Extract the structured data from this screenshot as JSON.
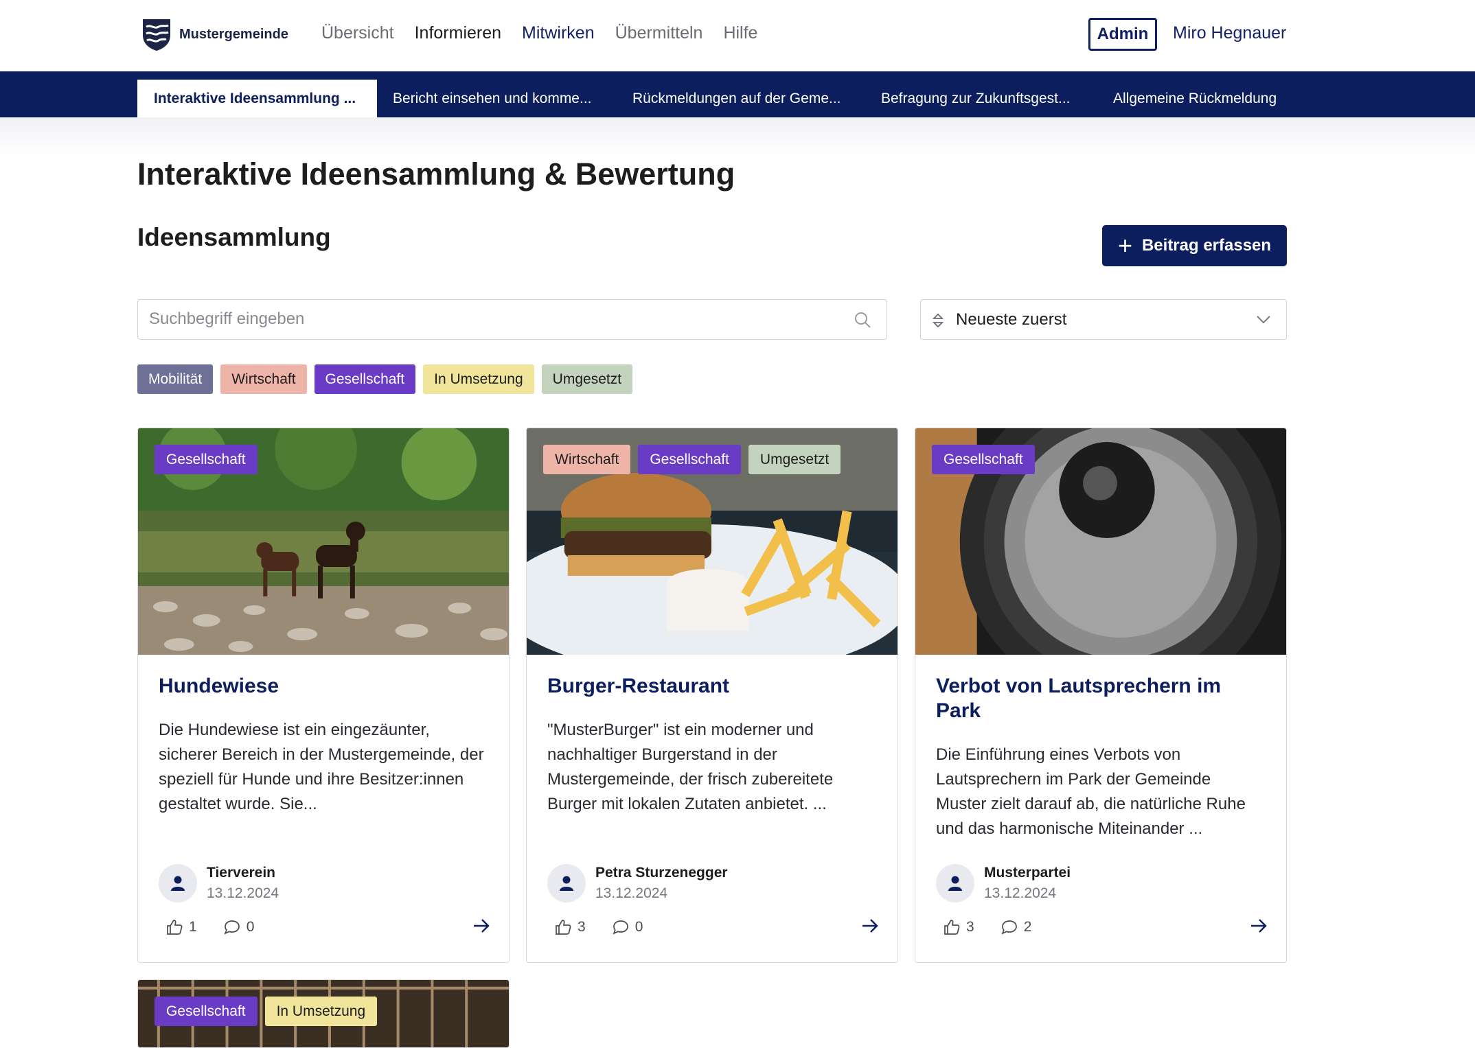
{
  "header": {
    "logo_text": "Mustergemeinde",
    "nav": [
      "Übersicht",
      "Informieren",
      "Mitwirken",
      "Übermitteln",
      "Hilfe"
    ],
    "admin_label": "Admin",
    "user_name": "Miro Hegnauer"
  },
  "tabs": [
    "Interaktive Ideensammlung ...",
    "Bericht einsehen und komme...",
    "Rückmeldungen auf der Geme...",
    "Befragung zur Zukunftsgest...",
    "Allgemeine Rückmeldung"
  ],
  "page": {
    "title": "Interaktive Ideensammlung & Bewertung",
    "section_title": "Ideensammlung",
    "add_button": "Beitrag erfassen",
    "search_placeholder": "Suchbegriff eingeben",
    "sort_label": "Neueste zuerst"
  },
  "filters": [
    "Mobilität",
    "Wirtschaft",
    "Gesellschaft",
    "In Umsetzung",
    "Umgesetzt"
  ],
  "colors": {
    "primary": "#0c1e5e",
    "mobilitaet": "#6f7096",
    "wirtschaft": "#efb4a8",
    "gesellschaft": "#6a3bc4",
    "in_umsetzung": "#f0e59a",
    "umgesetzt": "#c4d3bd"
  },
  "cards": [
    {
      "tags": [
        "Gesellschaft"
      ],
      "title": "Hundewiese",
      "description": "Die Hundewiese ist ein eingezäunter, sicherer Bereich in der Mustergemeinde, der speziell für Hunde und ihre Besitzer:innen gestaltet wurde. Sie...",
      "author": "Tierverein",
      "date": "13.12.2024",
      "likes": "1",
      "comments": "0"
    },
    {
      "tags": [
        "Wirtschaft",
        "Gesellschaft",
        "Umgesetzt"
      ],
      "title": "Burger-Restaurant",
      "description": "\"MusterBurger\" ist ein moderner und nachhaltiger Burgerstand in der Mustergemeinde, der frisch zubereitete Burger mit lokalen Zutaten anbietet. ...",
      "author": "Petra Sturzenegger",
      "date": "13.12.2024",
      "likes": "3",
      "comments": "0"
    },
    {
      "tags": [
        "Gesellschaft"
      ],
      "title": "Verbot von Lautsprechern im Park",
      "description": "Die Einführung eines Verbots von Lautsprechern im Park der Gemeinde Muster zielt darauf ab, die natürliche Ruhe und das harmonische Miteinander ...",
      "author": "Musterpartei",
      "date": "13.12.2024",
      "likes": "3",
      "comments": "2"
    },
    {
      "tags": [
        "Gesellschaft",
        "In Umsetzung"
      ]
    }
  ]
}
